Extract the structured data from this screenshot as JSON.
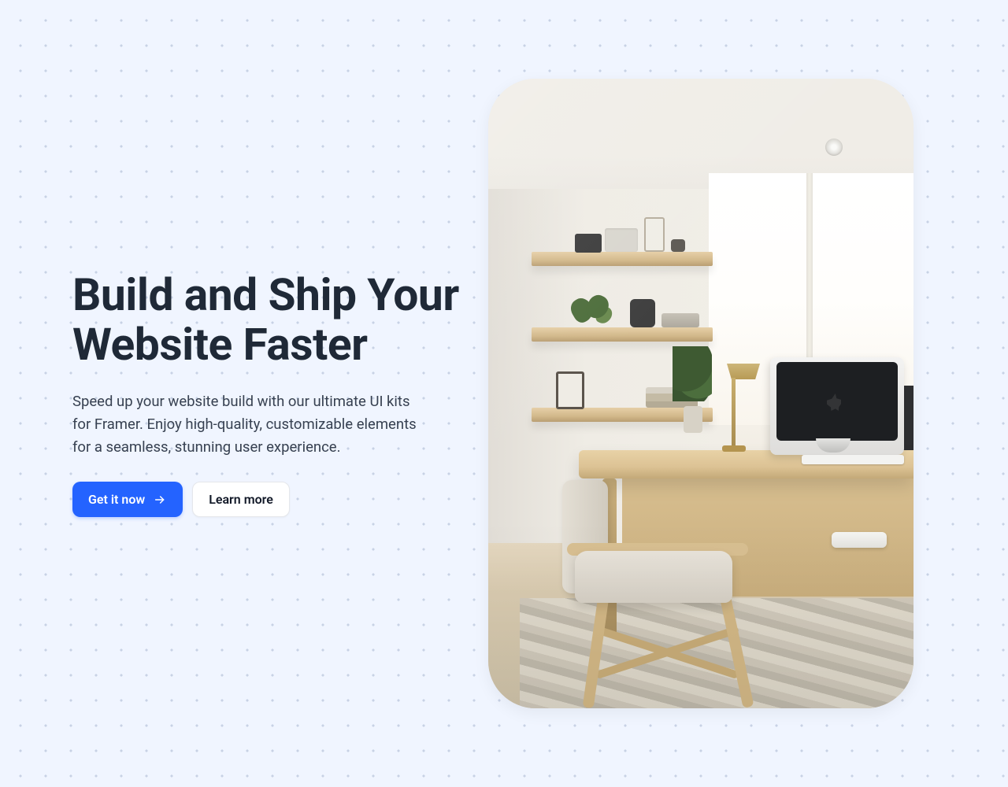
{
  "hero": {
    "title": "Build and Ship Your Website Faster",
    "subtitle": "Speed up your website build with our ultimate UI kits for Framer. Enjoy high-quality, customizable elements for a seamless, stunning user experience."
  },
  "cta": {
    "primary_label": "Get it now",
    "secondary_label": "Learn more"
  },
  "colors": {
    "page_bg": "#F0F5FF",
    "primary_button": "#2463FF",
    "text_dark": "#1f2937"
  },
  "image": {
    "description": "Minimal home office with wooden desk, iMac, brass lamp, floating wooden shelves with plants and decor, cream armchair, light wood floor and large window."
  }
}
